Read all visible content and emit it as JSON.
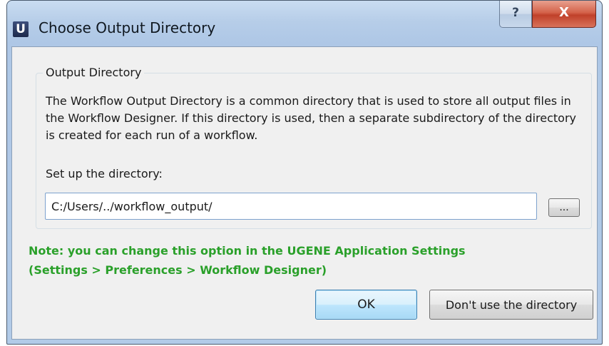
{
  "window": {
    "title": "Choose Output Directory",
    "app_icon_letter": "U",
    "help_glyph": "?",
    "close_glyph": "X"
  },
  "group": {
    "title": "Output Directory",
    "description": "The Workflow Output Directory is a common directory that is used to store all output files in the Workflow Designer. If this directory is used, then a separate subdirectory of the directory is created for each run of a workflow.",
    "setup_label": "Set up the directory:",
    "directory_value": "C:/Users/../workflow_output/",
    "browse_label": "..."
  },
  "note": {
    "line1": "Note: you can change this option in the UGENE Application Settings",
    "line2": "(Settings > Preferences > Workflow Designer)"
  },
  "buttons": {
    "ok_label": "OK",
    "dont_use_label": "Don't use the directory"
  },
  "colors": {
    "note_text": "#2aa02a",
    "close_button": "#c0412a",
    "default_button_border": "#3c7fb1"
  }
}
